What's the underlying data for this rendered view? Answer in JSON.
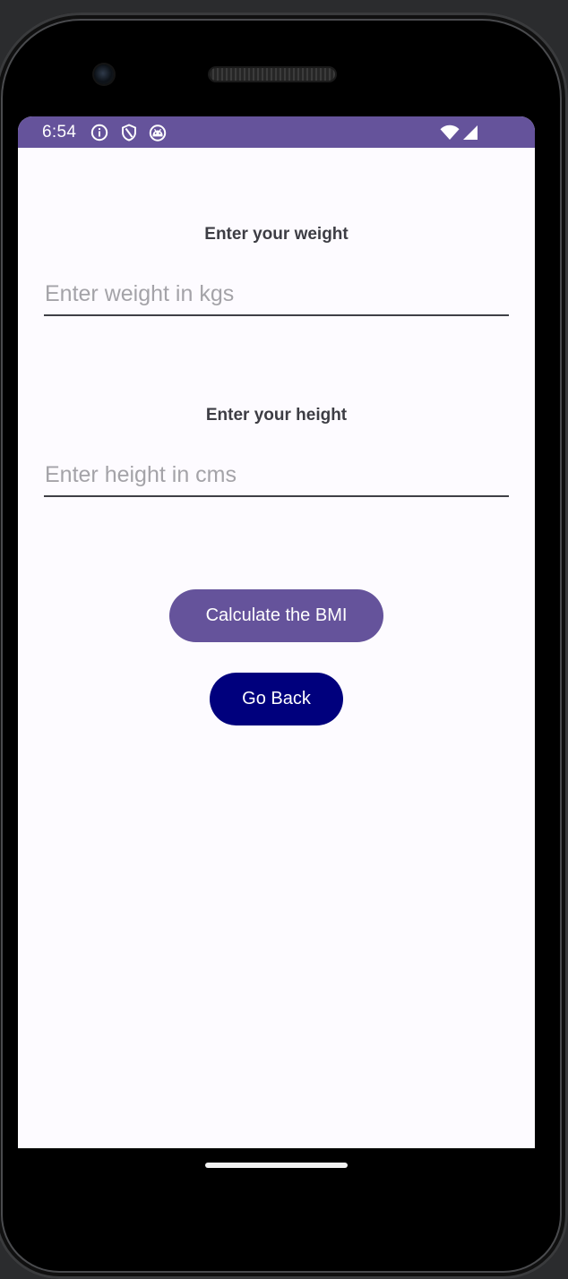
{
  "status_bar": {
    "time": "6:54",
    "left_icons": [
      "info-icon",
      "shield-icon",
      "android-icon"
    ],
    "right_icons": [
      "wifi-icon",
      "signal-icon"
    ],
    "color": "#65539b"
  },
  "form": {
    "weight": {
      "label": "Enter your weight",
      "placeholder": "Enter weight in kgs",
      "value": ""
    },
    "height": {
      "label": "Enter your height",
      "placeholder": "Enter height in cms",
      "value": ""
    }
  },
  "actions": {
    "calculate_label": "Calculate the BMI",
    "calculate_color": "#65539b",
    "back_label": "Go Back",
    "back_color": "#00007d"
  },
  "navigation": {
    "handle": "home-gesture-handle"
  }
}
